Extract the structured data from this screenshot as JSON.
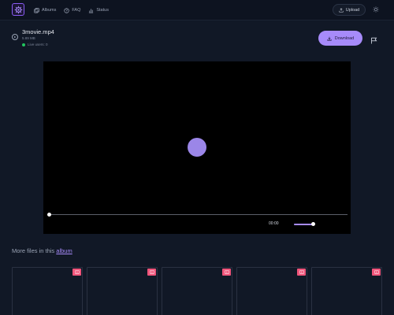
{
  "header": {
    "nav": [
      {
        "label": "Albums",
        "icon": "albums-icon"
      },
      {
        "label": "FAQ",
        "icon": "faq-icon"
      },
      {
        "label": "Status",
        "icon": "status-icon"
      }
    ],
    "upload_label": "Upload"
  },
  "file": {
    "name": "3movie.mp4",
    "size": "5.89 MB",
    "live_users": "Live users: 0"
  },
  "actions": {
    "download_label": "Download"
  },
  "player": {
    "time": "00:00",
    "progress": 0,
    "volume": 0.9
  },
  "more": {
    "prefix": "More files in this",
    "link": "album"
  },
  "cards": [
    {
      "badge_icon": "video-icon"
    },
    {
      "badge_icon": "video-icon"
    },
    {
      "badge_icon": "video-icon"
    },
    {
      "badge_icon": "video-icon"
    },
    {
      "badge_icon": "video-icon"
    }
  ],
  "colors": {
    "accent": "#a78bfa",
    "badge": "#f0547a",
    "live": "#22c55e",
    "background": "#111826"
  }
}
